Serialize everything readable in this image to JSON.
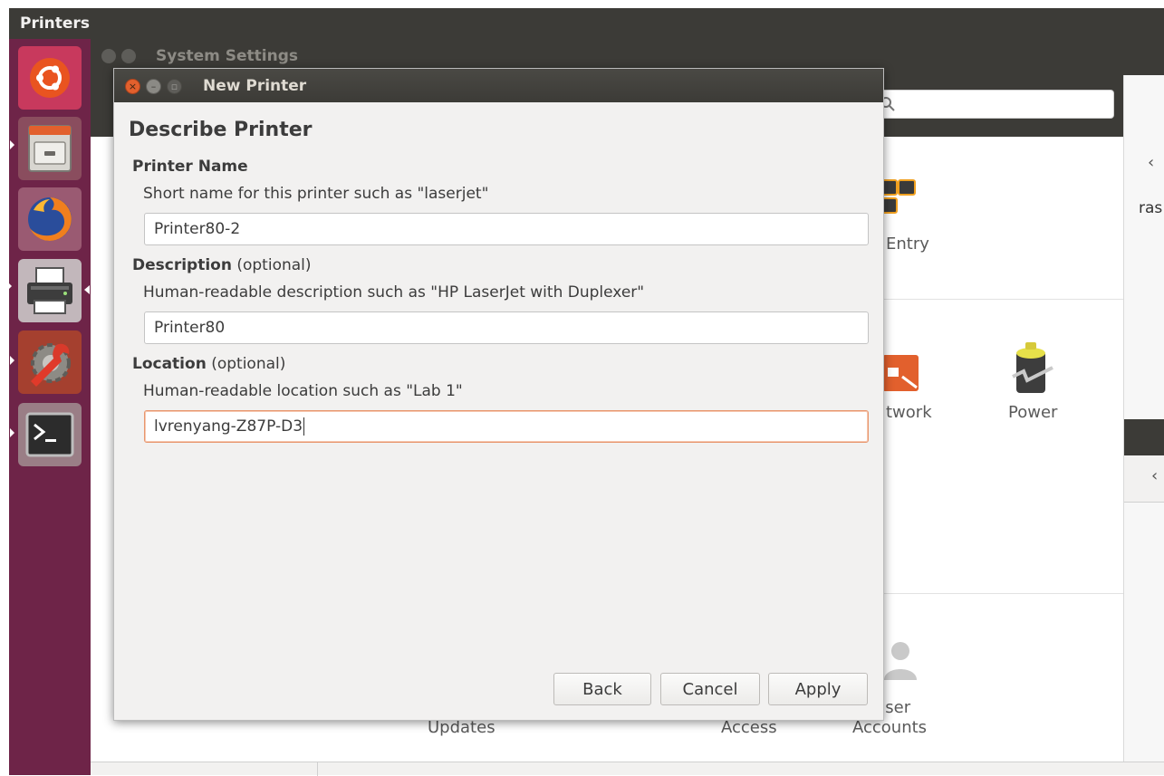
{
  "top_panel": {
    "app_title": "Printers"
  },
  "launcher": {
    "items": [
      {
        "name": "ubuntu-dash",
        "icon": "ubuntu-logo-icon"
      },
      {
        "name": "files",
        "icon": "file-cabinet-icon"
      },
      {
        "name": "firefox",
        "icon": "firefox-icon"
      },
      {
        "name": "printers",
        "icon": "printer-icon"
      },
      {
        "name": "system-settings",
        "icon": "wrench-gear-icon"
      },
      {
        "name": "terminal",
        "icon": "terminal-icon"
      }
    ]
  },
  "system_settings": {
    "title": "System Settings",
    "grid_labels": {
      "text_entry": "Entry",
      "network": "twork",
      "power": "Power",
      "updates": "Updates",
      "access": "Access",
      "user_accounts_line1": "Jser",
      "user_accounts_line2": "Accounts",
      "right_edge": "ras"
    }
  },
  "dialog": {
    "title": "New Printer",
    "heading": "Describe Printer",
    "printer_name": {
      "label": "Printer Name",
      "hint": "Short name for this printer such as \"laserjet\"",
      "value": "Printer80-2"
    },
    "description": {
      "label": "Description",
      "suffix": " (optional)",
      "hint": "Human-readable description such as \"HP LaserJet with Duplexer\"",
      "value": "Printer80"
    },
    "location": {
      "label": "Location",
      "suffix": " (optional)",
      "hint": "Human-readable location such as \"Lab 1\"",
      "value": "lvrenyang-Z87P-D3"
    },
    "buttons": {
      "back": "Back",
      "cancel": "Cancel",
      "apply": "Apply"
    }
  },
  "colors": {
    "launcher_bg": "#6e2448",
    "panel_bg": "#3c3b37",
    "close_button": "#e2602d",
    "focus_border": "#e8966d"
  }
}
